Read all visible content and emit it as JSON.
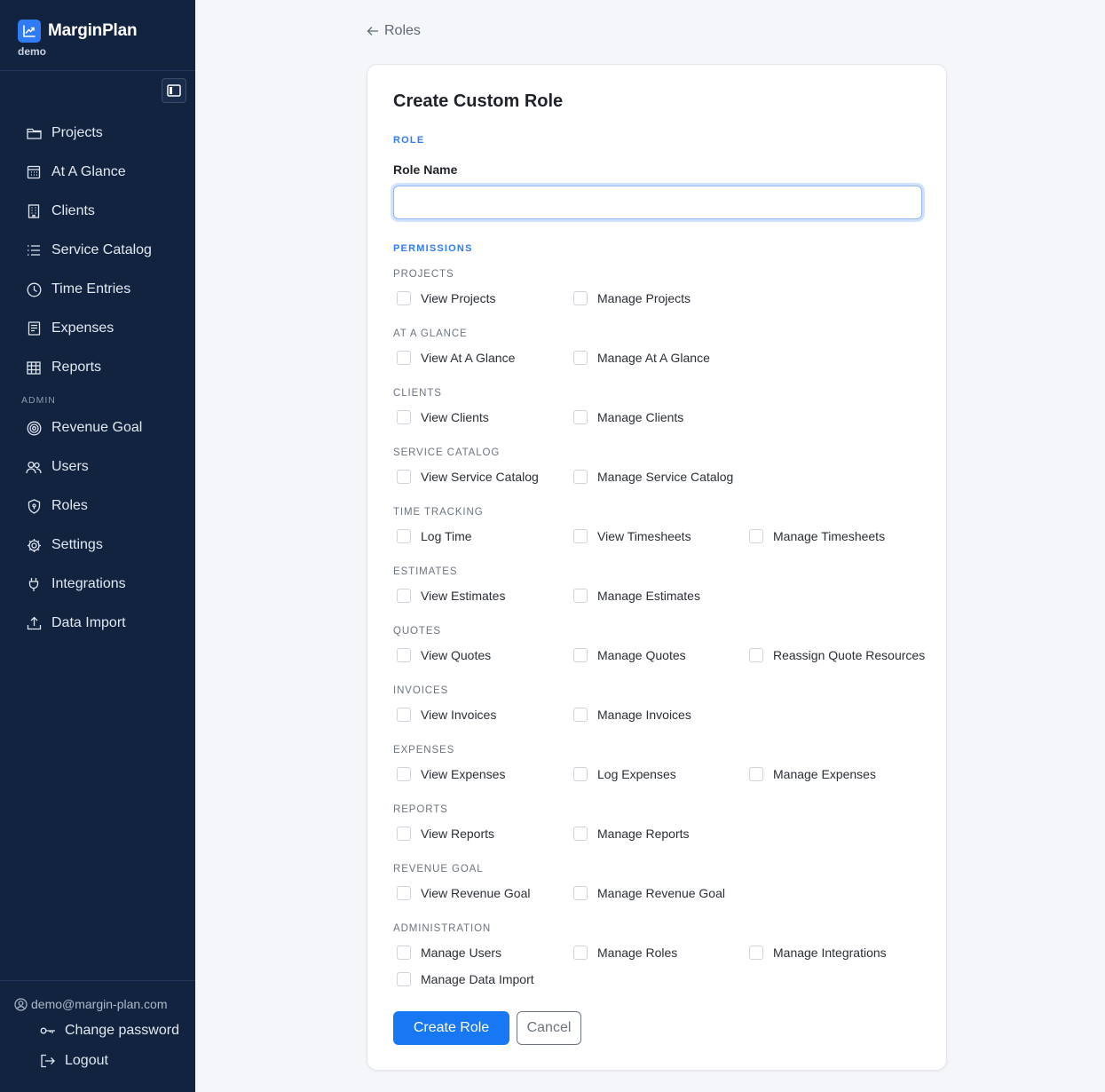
{
  "brand": {
    "name": "MarginPlan",
    "subtitle": "demo"
  },
  "sidebar": {
    "items": [
      {
        "label": "Projects",
        "icon": "folder-icon"
      },
      {
        "label": "At A Glance",
        "icon": "calendar-grid-icon"
      },
      {
        "label": "Clients",
        "icon": "building-icon"
      },
      {
        "label": "Service Catalog",
        "icon": "list-icon"
      },
      {
        "label": "Time Entries",
        "icon": "clock-icon"
      },
      {
        "label": "Expenses",
        "icon": "receipt-icon"
      },
      {
        "label": "Reports",
        "icon": "table-icon"
      }
    ],
    "admin_label": "ADMIN",
    "admin_items": [
      {
        "label": "Revenue Goal",
        "icon": "target-icon"
      },
      {
        "label": "Users",
        "icon": "users-icon"
      },
      {
        "label": "Roles",
        "icon": "shield-icon"
      },
      {
        "label": "Settings",
        "icon": "gear-icon"
      },
      {
        "label": "Integrations",
        "icon": "plug-icon"
      },
      {
        "label": "Data Import",
        "icon": "upload-icon"
      }
    ],
    "user_email": "demo@margin-plan.com",
    "change_password": "Change password",
    "logout": "Logout"
  },
  "back_link": "Roles",
  "form": {
    "title": "Create Custom Role",
    "role_section": "ROLE",
    "role_name_label": "Role Name",
    "role_name_value": "",
    "permissions_section": "PERMISSIONS",
    "groups": [
      {
        "label": "PROJECTS",
        "perms": [
          "View Projects",
          "Manage Projects"
        ]
      },
      {
        "label": "AT A GLANCE",
        "perms": [
          "View At A Glance",
          "Manage At A Glance"
        ]
      },
      {
        "label": "CLIENTS",
        "perms": [
          "View Clients",
          "Manage Clients"
        ]
      },
      {
        "label": "SERVICE CATALOG",
        "perms": [
          "View Service Catalog",
          "Manage Service Catalog"
        ]
      },
      {
        "label": "TIME TRACKING",
        "perms": [
          "Log Time",
          "View Timesheets",
          "Manage Timesheets"
        ]
      },
      {
        "label": "ESTIMATES",
        "perms": [
          "View Estimates",
          "Manage Estimates"
        ]
      },
      {
        "label": "QUOTES",
        "perms": [
          "View Quotes",
          "Manage Quotes",
          "Reassign Quote Resources"
        ]
      },
      {
        "label": "INVOICES",
        "perms": [
          "View Invoices",
          "Manage Invoices"
        ]
      },
      {
        "label": "EXPENSES",
        "perms": [
          "View Expenses",
          "Log Expenses",
          "Manage Expenses"
        ]
      },
      {
        "label": "REPORTS",
        "perms": [
          "View Reports",
          "Manage Reports"
        ]
      },
      {
        "label": "REVENUE GOAL",
        "perms": [
          "View Revenue Goal",
          "Manage Revenue Goal"
        ]
      },
      {
        "label": "ADMINISTRATION",
        "perms": [
          "Manage Users",
          "Manage Roles",
          "Manage Integrations",
          "Manage Data Import"
        ]
      }
    ],
    "submit_label": "Create Role",
    "cancel_label": "Cancel"
  },
  "colors": {
    "sidebar_bg": "#12233f",
    "accent": "#1877f2",
    "page_bg": "#f4f6f9"
  }
}
